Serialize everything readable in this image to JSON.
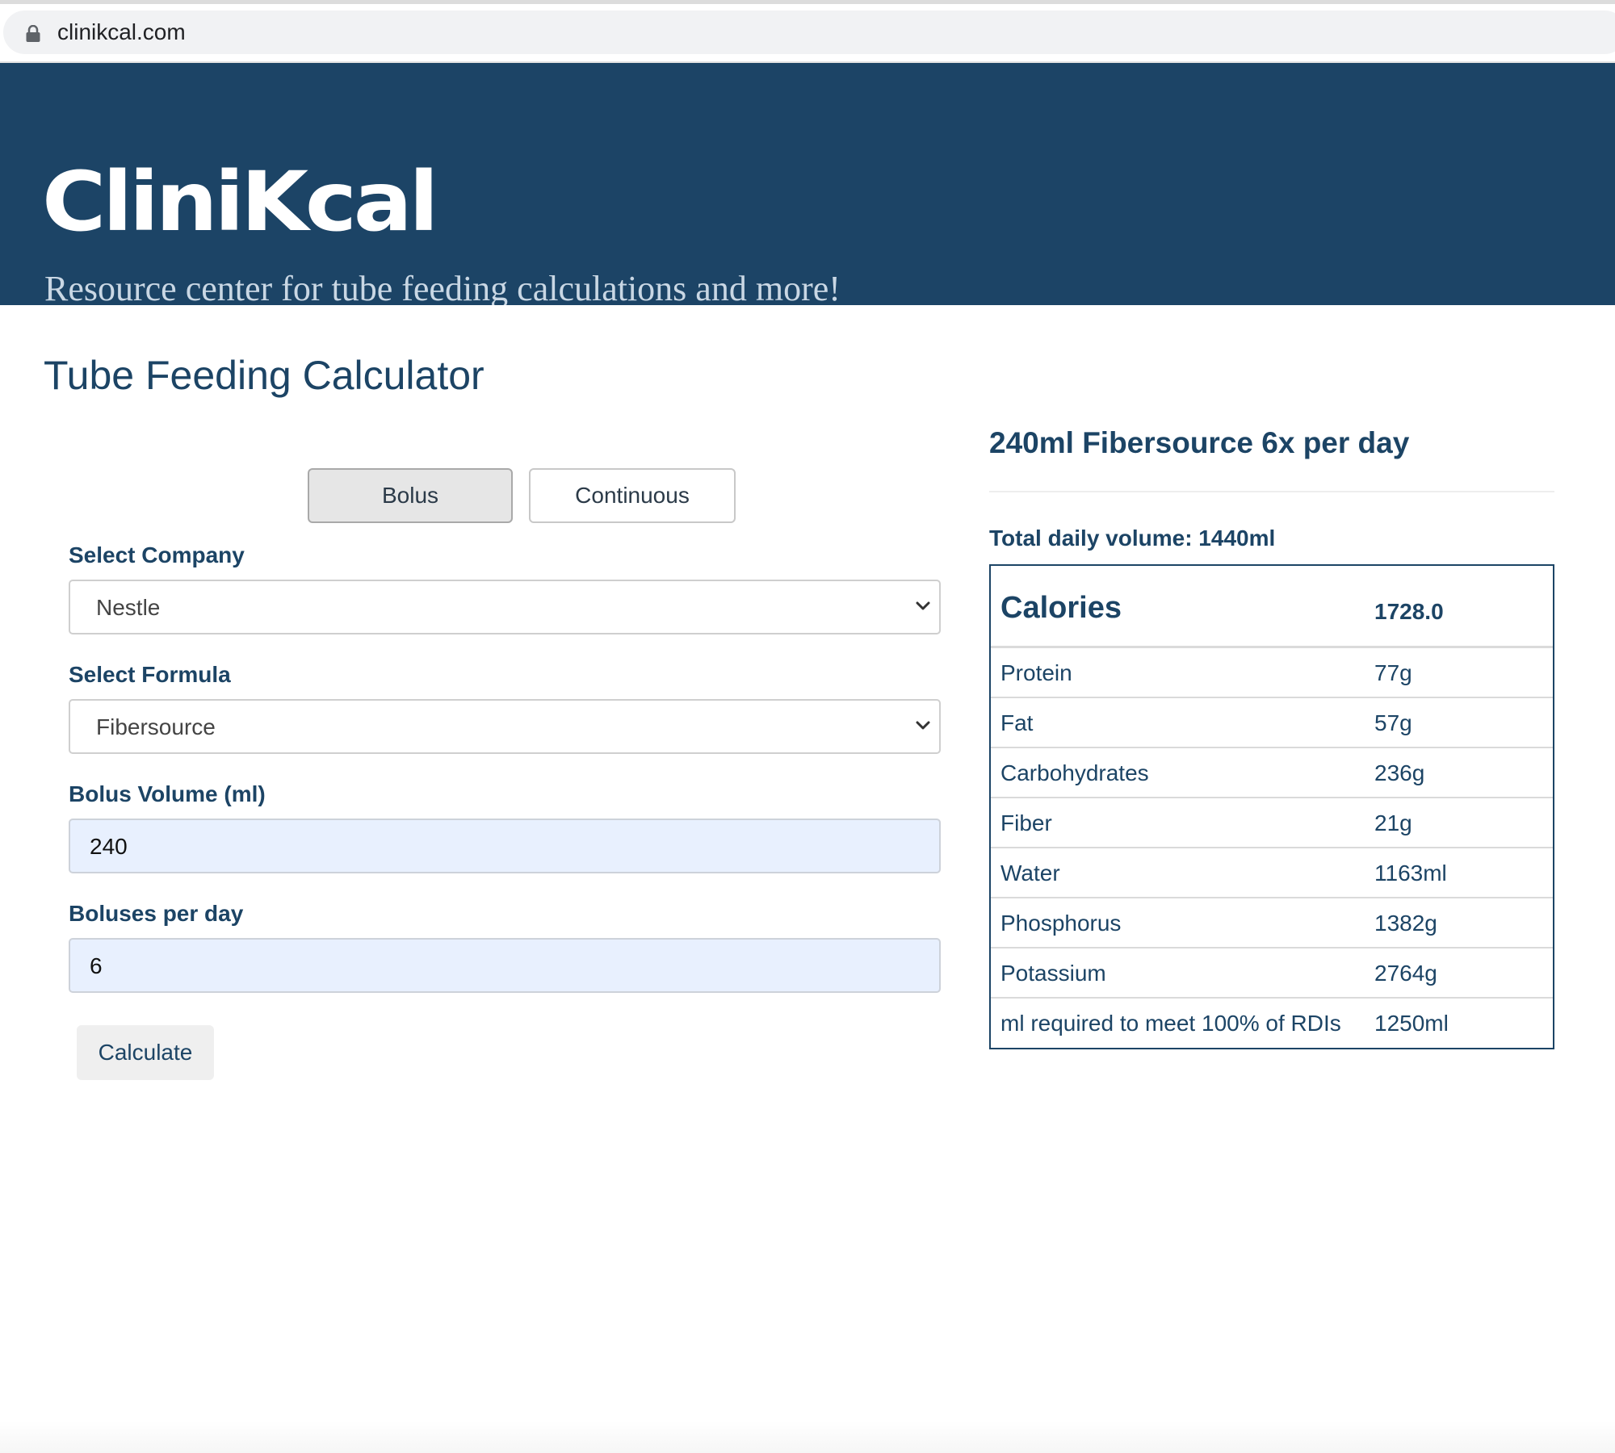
{
  "browser": {
    "url": "clinikcal.com",
    "icons": {
      "lock": "lock-icon"
    }
  },
  "header": {
    "logo": "CliniKcal",
    "tagline": "Resource center for tube feeding calculations and more!",
    "colors": {
      "background": "#1c4466",
      "logo": "#ffffff",
      "tagline": "#c9d7e4"
    }
  },
  "main": {
    "title": "Tube Feeding Calculator",
    "modes": [
      {
        "label": "Bolus",
        "selected": true
      },
      {
        "label": "Continuous",
        "selected": false
      }
    ],
    "form": {
      "company": {
        "label": "Select Company",
        "value": "Nestle"
      },
      "formula": {
        "label": "Select Formula",
        "value": "Fibersource"
      },
      "bolus_volume": {
        "label": "Bolus Volume (ml)",
        "value": "240"
      },
      "boluses_per_day": {
        "label": "Boluses per day",
        "value": "6"
      },
      "submit_label": "Calculate"
    }
  },
  "results": {
    "title": "240ml Fibersource 6x per day",
    "total_daily_volume": "Total daily volume: 1440ml",
    "header_row": {
      "label": "Calories",
      "value": "1728.0"
    },
    "rows": [
      {
        "label": "Protein",
        "value": "77g"
      },
      {
        "label": "Fat",
        "value": "57g"
      },
      {
        "label": "Carbohydrates",
        "value": "236g"
      },
      {
        "label": "Fiber",
        "value": "21g"
      },
      {
        "label": "Water",
        "value": "1163ml"
      },
      {
        "label": "Phosphorus",
        "value": "1382g"
      },
      {
        "label": "Potassium",
        "value": "2764g"
      },
      {
        "label": "ml required to meet 100% of RDIs",
        "value": "1250ml"
      }
    ]
  },
  "colors": {
    "accent": "#1c4465",
    "input_fill": "#e8f0fe"
  }
}
